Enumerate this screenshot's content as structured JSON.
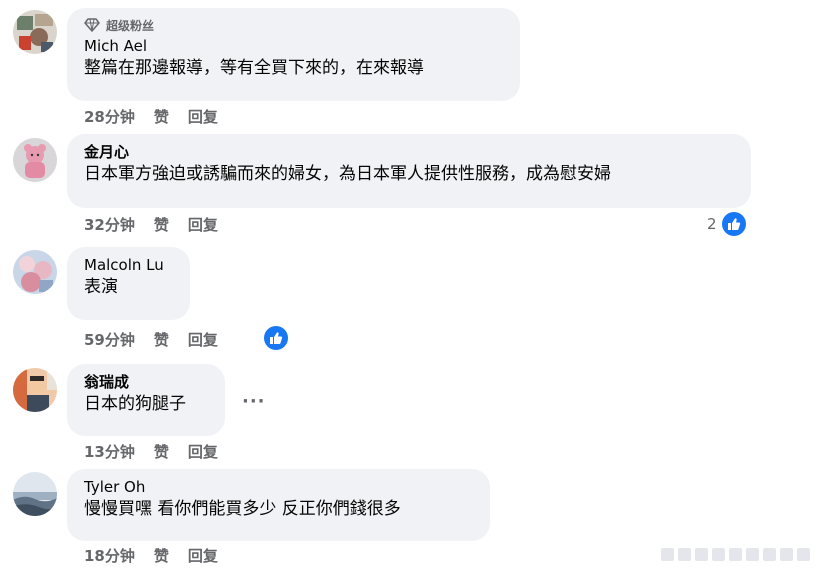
{
  "comments": [
    {
      "badge": "超级粉丝",
      "author": "Mich Ael",
      "text": "整篇在那邊報導，等有全買下來的，在來報導",
      "time": "28分钟",
      "like_label": "赞",
      "reply_label": "回复"
    },
    {
      "author": "金月心",
      "text": "日本軍方強迫或誘騙而來的婦女，為日本軍人提供性服務，成為慰安婦",
      "time": "32分钟",
      "like_label": "赞",
      "reply_label": "回复",
      "reaction_count": "2"
    },
    {
      "author": "Malcoln Lu",
      "text": "表演",
      "time": "59分钟",
      "like_label": "赞",
      "reply_label": "回复"
    },
    {
      "author": "翁瑞成",
      "text": "日本的狗腿子",
      "time": "13分钟",
      "like_label": "赞",
      "reply_label": "回复",
      "more_label": "···"
    },
    {
      "author": "Tyler Oh",
      "text": "慢慢買嘿 看你們能買多少 反正你們錢很多",
      "time": "18分钟",
      "like_label": "赞",
      "reply_label": "回复"
    }
  ],
  "colors": {
    "bubble_bg": "#f0f2f5",
    "meta_text": "#65676b",
    "like_blue": "#1877f2"
  },
  "icons": {
    "badge": "diamond-icon",
    "reaction": "thumbs-up-icon"
  }
}
